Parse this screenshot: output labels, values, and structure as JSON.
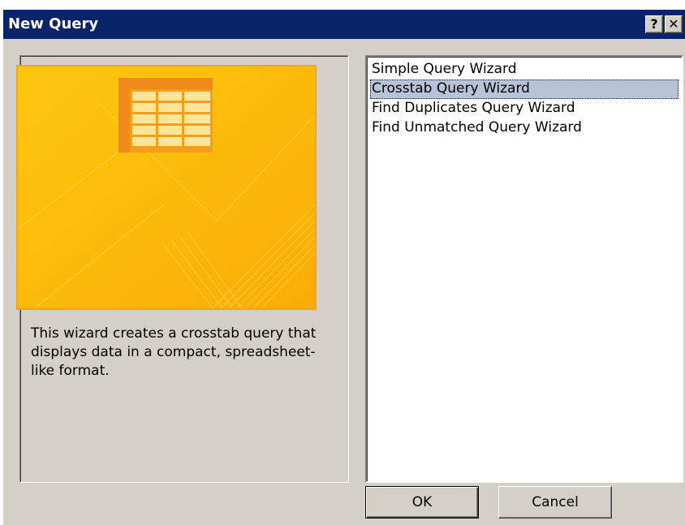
{
  "window": {
    "title": "New Query",
    "help_label": "?",
    "close_label": "✕"
  },
  "illustration": {
    "icon": "table-icon",
    "colors": {
      "background": "#fbb80a",
      "border": "#f7a21a",
      "table": "#f5a623"
    }
  },
  "description": "This wizard creates a crosstab query that displays data in a compact, spreadsheet-like format.",
  "wizards": [
    {
      "label": "Simple Query Wizard",
      "selected": false
    },
    {
      "label": "Crosstab Query Wizard",
      "selected": true
    },
    {
      "label": "Find Duplicates Query Wizard",
      "selected": false
    },
    {
      "label": "Find Unmatched Query Wizard",
      "selected": false
    }
  ],
  "buttons": {
    "ok": "OK",
    "cancel": "Cancel"
  }
}
